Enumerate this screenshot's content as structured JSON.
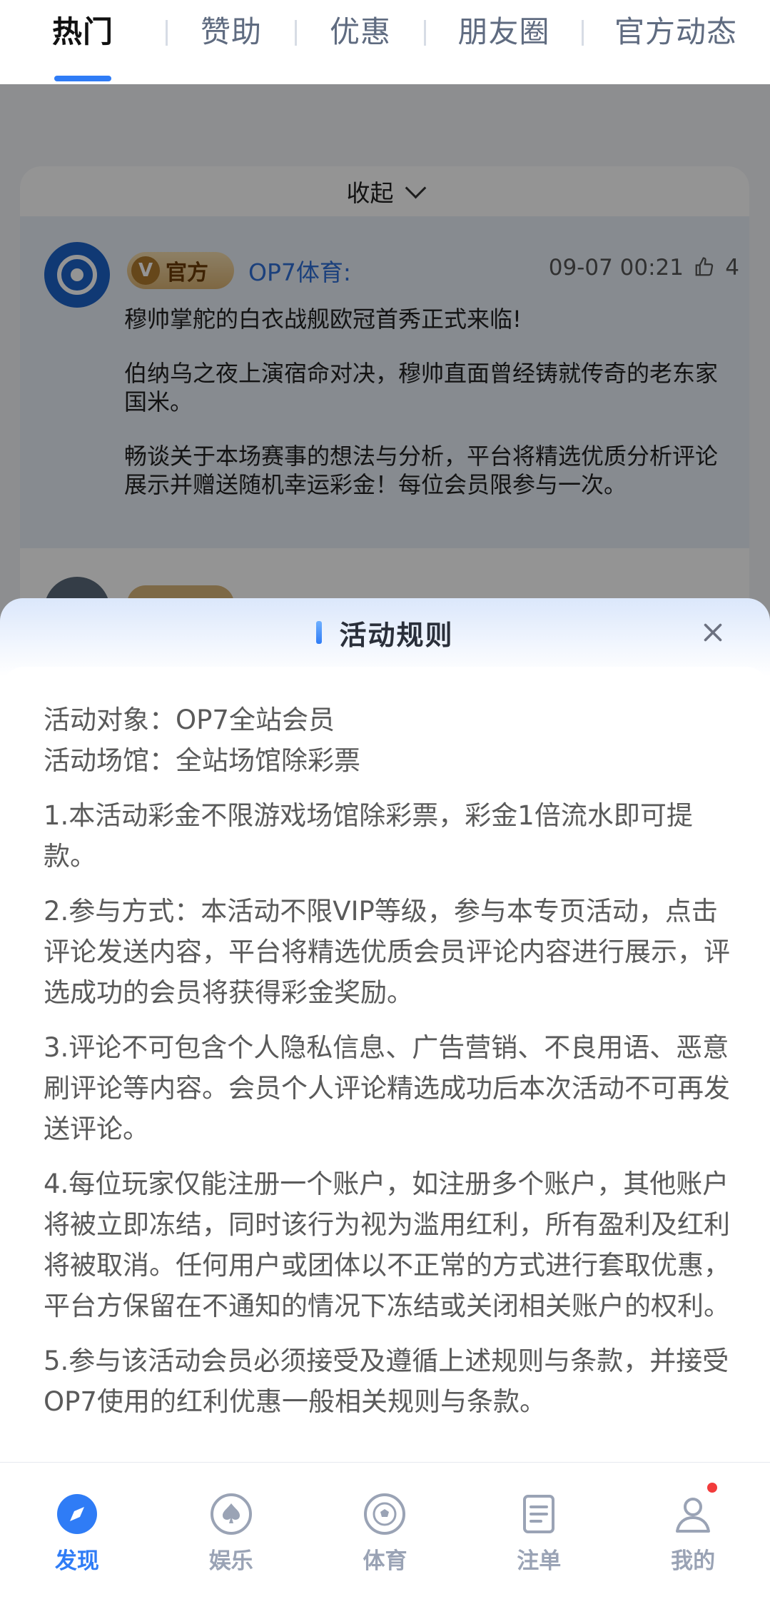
{
  "tabs": [
    {
      "label": "热门",
      "active": true
    },
    {
      "label": "赞助",
      "active": false
    },
    {
      "label": "优惠",
      "active": false
    },
    {
      "label": "朋友圈",
      "active": false
    },
    {
      "label": "官方动态",
      "active": false
    }
  ],
  "feed": {
    "collapse_label": "收起",
    "post": {
      "badge_letter": "V",
      "badge_text": "官方",
      "author": "OP7体育:",
      "time": "09-07 00:21",
      "likes": "4",
      "paragraphs": [
        "穆帅掌舵的白衣战舰欧冠首秀正式来临!",
        "伯纳乌之夜上演宿命对决，穆帅直面曾经铸就传奇的老东家国米。",
        "畅谈关于本场赛事的想法与分析，平台将精选优质分析评论展示并赠送随机幸运彩金！每位会员限参与一次。"
      ]
    }
  },
  "sheet": {
    "title": "活动规则",
    "meta": [
      "活动对象：OP7全站会员",
      "活动场馆：全站场馆除彩票"
    ],
    "rules": [
      "1.本活动彩金不限游戏场馆除彩票，彩金1倍流水即可提款。",
      "2.参与方式：本活动不限VIP等级，参与本专页活动，点击评论发送内容，平台将精选优质会员评论内容进行展示，评选成功的会员将获得彩金奖励。",
      "3.评论不可包含个人隐私信息、广告营销、不良用语、恶意刷评论等内容。会员个人评论精选成功后本次活动不可再发送评论。",
      "4.每位玩家仅能注册一个账户，如注册多个账户，其他账户将被立即冻结，同时该行为视为滥用红利，所有盈利及红利将被取消。任何用户或团体以不正常的方式进行套取优惠，平台方保留在不通知的情况下冻结或关闭相关账户的权利。",
      "5.参与该活动会员必须接受及遵循上述规则与条款，并接受OP7使用的红利优惠一般相关规则与条款。"
    ]
  },
  "bottom_nav": [
    {
      "label": "发现",
      "icon": "compass-icon",
      "active": true
    },
    {
      "label": "娱乐",
      "icon": "spade-icon",
      "active": false
    },
    {
      "label": "体育",
      "icon": "soccer-ball-icon",
      "active": false
    },
    {
      "label": "注单",
      "icon": "document-icon",
      "active": false
    },
    {
      "label": "我的",
      "icon": "user-icon",
      "active": false,
      "notification_dot": true
    }
  ],
  "colors": {
    "accent": "#2f7cf6",
    "nav_inactive": "#9aa3b5",
    "notification": "#f23b3b"
  }
}
